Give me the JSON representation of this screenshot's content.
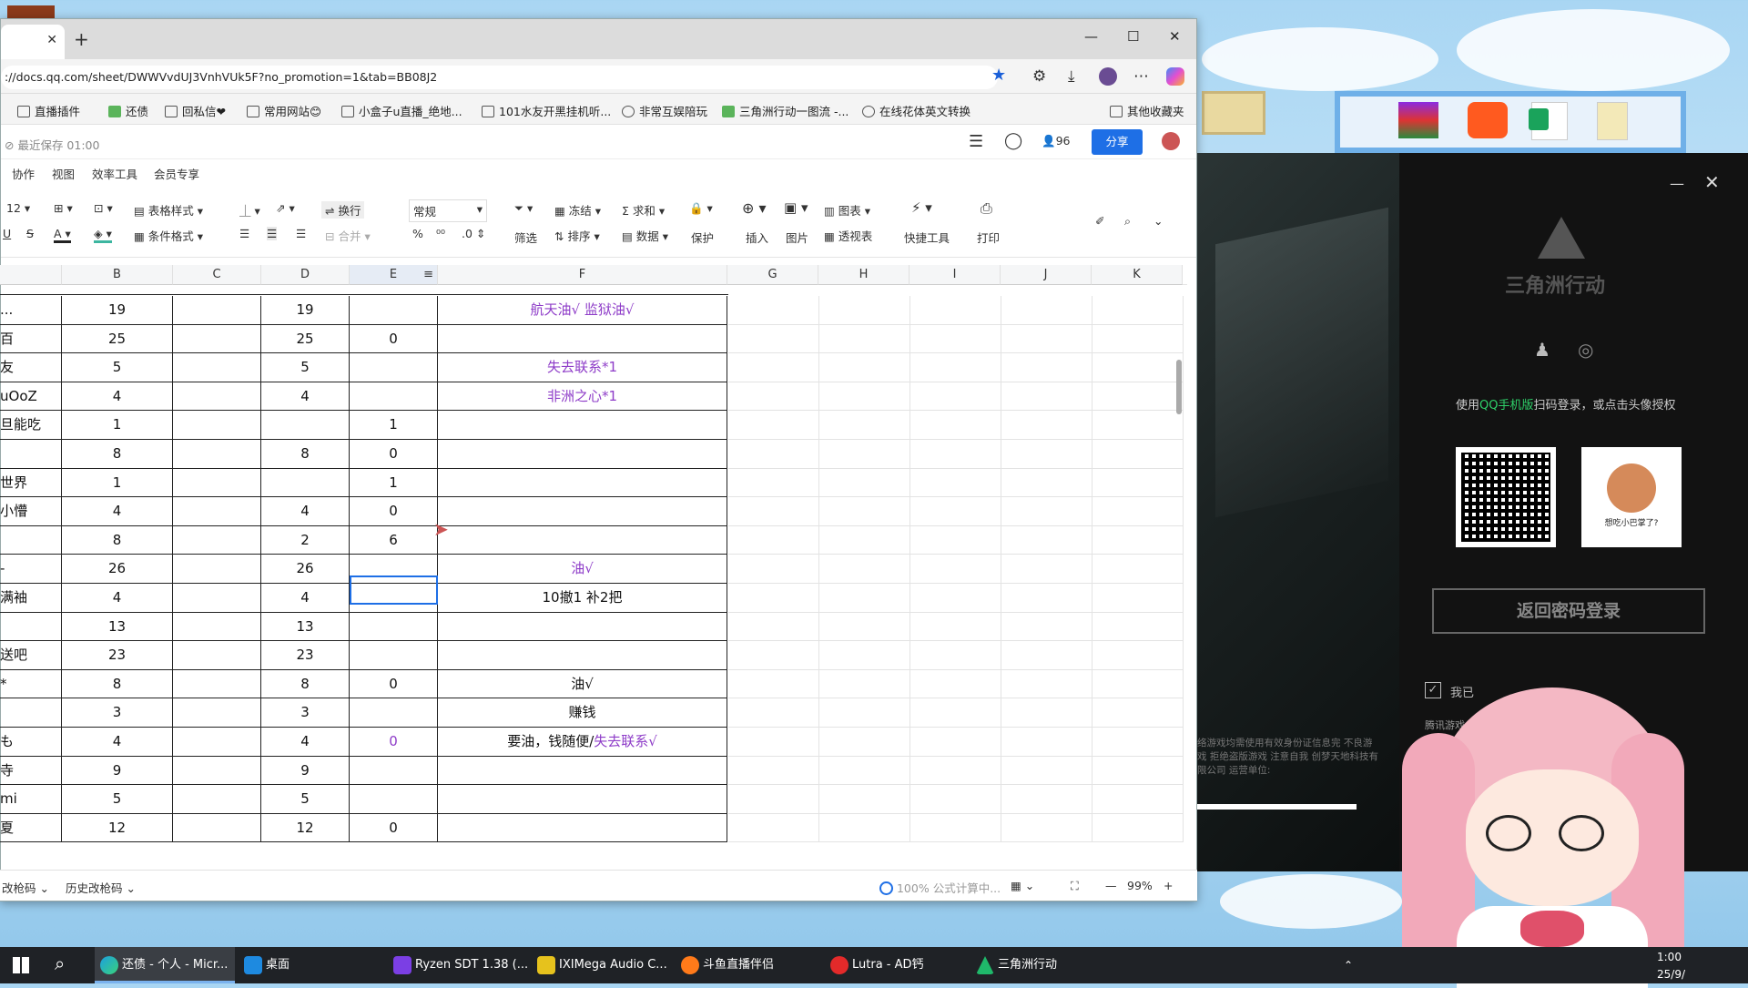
{
  "browser": {
    "url": "://docs.qq.com/sheet/DWWVvdUJ3VnhVUk5F?no_promotion=1&tab=BB08J2",
    "bookmarks": [
      "直播插件",
      "还债",
      "回私信❤",
      "常用网站😊",
      "小盒子u直播_绝地...",
      "101水友开黑挂机听...",
      "非常互娱陪玩",
      "三角洲行动一图流 -...",
      "在线花体英文转换",
      "其他收藏夹"
    ]
  },
  "doc": {
    "saved": "最近保存 01:00",
    "collab_count": "96",
    "share": "分享",
    "menu": [
      "协作",
      "视图",
      "效率工具",
      "会员专享"
    ],
    "ribbon": {
      "fontsize": "12",
      "table_style": "表格样式",
      "cond_format": "条件格式",
      "wrap": "换行",
      "merge": "合并",
      "number_format": "常规",
      "percent": "%",
      "thousands": "⁰⁰",
      "decimals": ".0",
      "freeze": "冻结",
      "sum": "求和",
      "filter": "筛选",
      "sort": "排序",
      "data": "数据",
      "protect": "保护",
      "insert": "插入",
      "image": "图片",
      "chart": "图表",
      "pivot": "透视表",
      "quick_tools": "快捷工具",
      "print": "打印"
    },
    "columns": [
      "B",
      "C",
      "D",
      "E",
      "F",
      "G",
      "H",
      "I",
      "J",
      "K"
    ],
    "rows": [
      {
        "a": "...",
        "b": "19",
        "d": "19",
        "e": "",
        "f": "航天油√ 监狱油√",
        "fp": true
      },
      {
        "a": "百",
        "b": "25",
        "d": "25",
        "e": "0",
        "f": ""
      },
      {
        "a": "友",
        "b": "5",
        "d": "5",
        "e": "",
        "f": "失去联系*1",
        "fp": true
      },
      {
        "a": "uOoZ",
        "b": "4",
        "d": "4",
        "e": "",
        "f": "非洲之心*1",
        "fp": true
      },
      {
        "a": "旦能吃",
        "b": "1",
        "d": "",
        "e": "1",
        "f": ""
      },
      {
        "a": "",
        "b": "8",
        "d": "8",
        "e": "0",
        "f": ""
      },
      {
        "a": "世界",
        "b": "1",
        "d": "",
        "e": "1",
        "f": ""
      },
      {
        "a": "小懵",
        "b": "4",
        "d": "4",
        "e": "0",
        "f": ""
      },
      {
        "a": "",
        "b": "8",
        "d": "2",
        "e": "6",
        "f": ""
      },
      {
        "a": "-",
        "b": "26",
        "d": "26",
        "e": "",
        "f": "油√",
        "fp": true
      },
      {
        "a": "满袖",
        "b": "4",
        "d": "4",
        "e": "",
        "f": "10撤1 补2把"
      },
      {
        "a": "",
        "b": "13",
        "d": "13",
        "e": "",
        "f": ""
      },
      {
        "a": "送吧",
        "b": "23",
        "d": "23",
        "e": "",
        "f": ""
      },
      {
        "a": "*",
        "b": "8",
        "d": "8",
        "e": "0",
        "f": "油√"
      },
      {
        "a": "",
        "b": "3",
        "d": "3",
        "e": "",
        "f": "赚钱"
      },
      {
        "a": "も",
        "b": "4",
        "d": "4",
        "e": "0",
        "ep": true,
        "f": "要油，钱随便/",
        "f2": "失去联系√"
      },
      {
        "a": "寺",
        "b": "9",
        "d": "9",
        "e": "",
        "f": ""
      },
      {
        "a": "mi",
        "b": "5",
        "d": "5",
        "e": "",
        "f": ""
      },
      {
        "a": "夏",
        "b": "12",
        "d": "12",
        "e": "0",
        "f": ""
      }
    ],
    "status": {
      "left1": "改枪码",
      "left2": "历史改枪码",
      "calc": "100% 公式计算中...",
      "zoom": "99%"
    }
  },
  "game": {
    "logo": "三角洲行动",
    "login_hint_prefix": "使用",
    "login_hint_qq": "QQ手机版",
    "login_hint_suffix": "扫码登录，或点击头像授权",
    "avatar_caption": "想吃小巴掌了?",
    "password_login": "返回密码登录",
    "agree_prefix": "我已",
    "tencent": "腾讯游戏",
    "notice": "络游戏均需使用有效身份证信息完 不良游戏 拒绝盗版游戏 注意自我 创梦天地科技有限公司 运营单位:"
  },
  "taskbar": {
    "items": [
      "还债 - 个人 - Micr...",
      "桌面",
      "Ryzen SDT 1.38 (...",
      "IXIMega Audio C...",
      "斗鱼直播伴侣",
      "Lutra - AD钙",
      "三角洲行动"
    ],
    "time": "1:00",
    "date": "25/9/"
  },
  "colors": {
    "accent": "#1e6fe6",
    "purple": "#8e3cc8",
    "qq_green": "#2fd26a"
  }
}
